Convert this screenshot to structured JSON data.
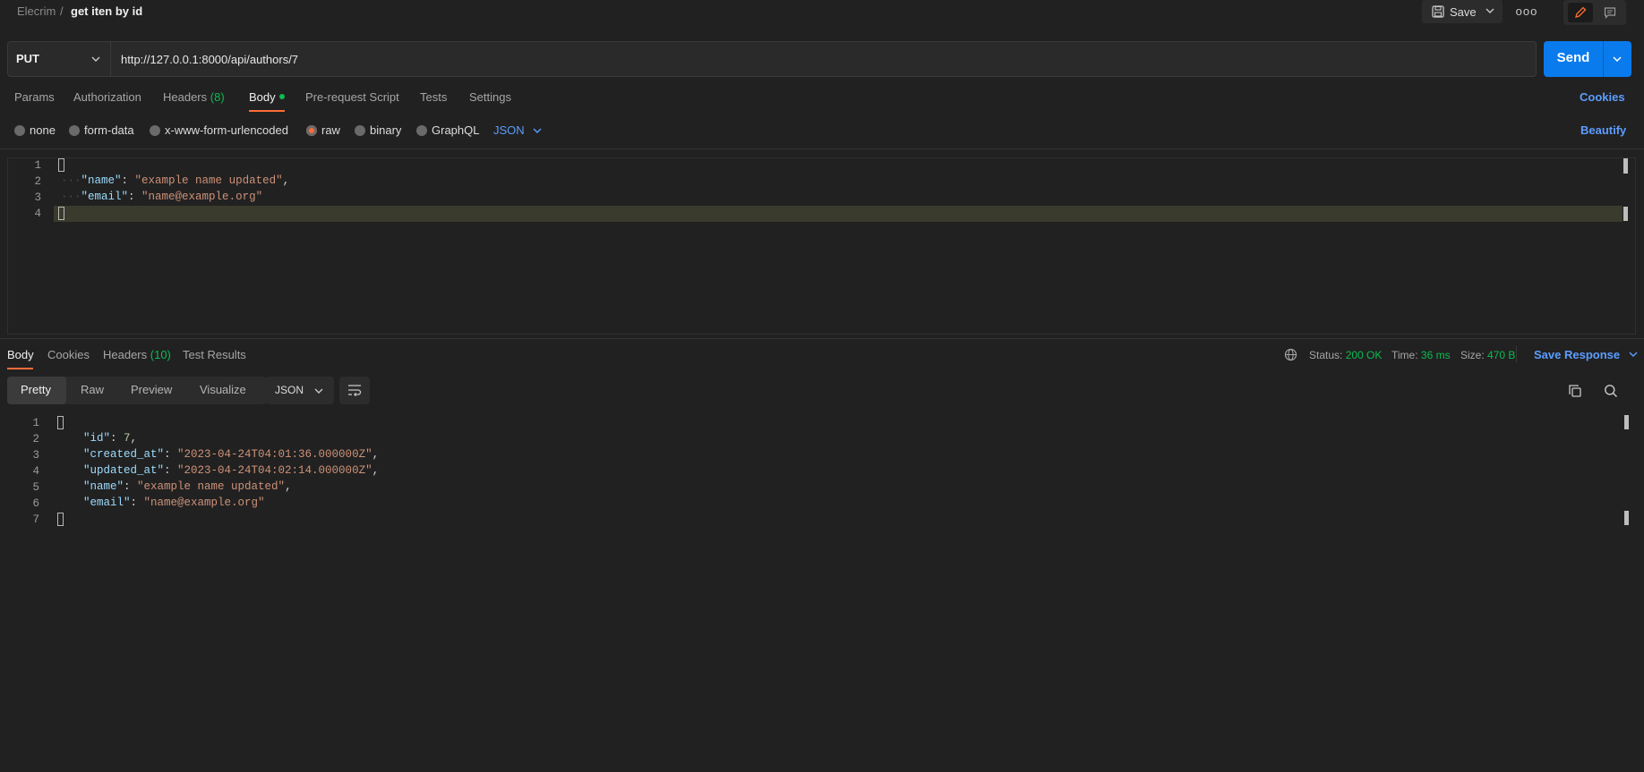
{
  "breadcrumb": {
    "workspace": "Elecrim",
    "separator": "/",
    "request_name": "get iten by id"
  },
  "header": {
    "save_label": "Save",
    "more_label": "ooo"
  },
  "request": {
    "method": "PUT",
    "url": "http://127.0.0.1:8000/api/authors/7",
    "send_label": "Send"
  },
  "request_tabs": {
    "params": "Params",
    "authorization": "Authorization",
    "headers": "Headers",
    "headers_count": "(8)",
    "body": "Body",
    "prerequest": "Pre-request Script",
    "tests": "Tests",
    "settings": "Settings",
    "cookies": "Cookies"
  },
  "body_types": {
    "none": "none",
    "form_data": "form-data",
    "urlencoded": "x-www-form-urlencoded",
    "raw": "raw",
    "binary": "binary",
    "graphql": "GraphQL",
    "selected_format": "JSON",
    "beautify": "Beautify"
  },
  "request_body": {
    "line_numbers": [
      "1",
      "2",
      "3",
      "4"
    ],
    "name_key": "\"name\"",
    "name_value": "\"example name updated\"",
    "email_key": "\"email\"",
    "email_value": "\"name@example.org\""
  },
  "response_tabs": {
    "body": "Body",
    "cookies": "Cookies",
    "headers": "Headers",
    "headers_count": "(10)",
    "test_results": "Test Results"
  },
  "response_meta": {
    "status_label": "Status:",
    "status_value": "200 OK",
    "time_label": "Time:",
    "time_value": "36 ms",
    "size_label": "Size:",
    "size_value": "470 B",
    "save_response": "Save Response"
  },
  "response_view": {
    "pretty": "Pretty",
    "raw": "Raw",
    "preview": "Preview",
    "visualize": "Visualize",
    "format": "JSON"
  },
  "response_body": {
    "line_numbers": [
      "1",
      "2",
      "3",
      "4",
      "5",
      "6",
      "7"
    ],
    "id_key": "\"id\"",
    "id_value": "7",
    "created_key": "\"created_at\"",
    "created_value": "\"2023-04-24T04:01:36.000000Z\"",
    "updated_key": "\"updated_at\"",
    "updated_value": "\"2023-04-24T04:02:14.000000Z\"",
    "name_key": "\"name\"",
    "name_value": "\"example name updated\"",
    "email_key": "\"email\"",
    "email_value": "\"name@example.org\""
  },
  "colors": {
    "accent_orange": "#ff6c37",
    "send_blue": "#097bed",
    "link_blue": "#5b9dff",
    "status_green": "#0cbb52"
  }
}
